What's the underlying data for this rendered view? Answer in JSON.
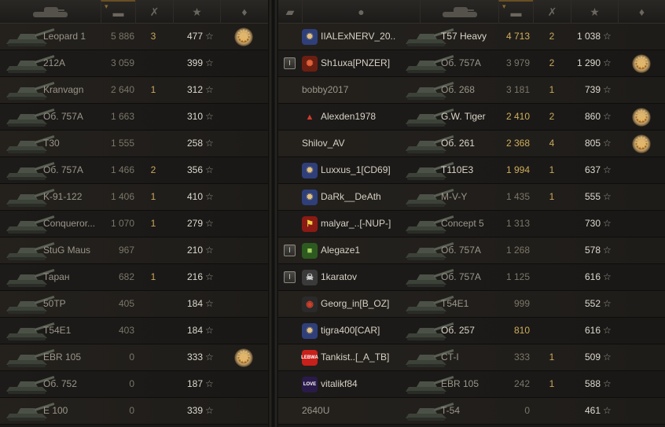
{
  "header": {
    "icons": [
      "clan-icon",
      "player-icon",
      "tank-icon",
      "damage-icon",
      "tracked-kills-icon",
      "experience-star-icon",
      "medal-icon"
    ],
    "sort_caret": "▾"
  },
  "star_glyph": "☆",
  "left_team": [
    {
      "tank": "Leopard 1",
      "damage": "5 886",
      "kills": "3",
      "xp": "477",
      "medal": true
    },
    {
      "tank": "212A",
      "damage": "3 059",
      "kills": "",
      "xp": "399",
      "medal": false
    },
    {
      "tank": "Kranvagn",
      "damage": "2 640",
      "kills": "1",
      "xp": "312",
      "medal": false
    },
    {
      "tank": "Об. 757A",
      "damage": "1 663",
      "kills": "",
      "xp": "310",
      "medal": false
    },
    {
      "tank": "T30",
      "damage": "1 555",
      "kills": "",
      "xp": "258",
      "medal": false
    },
    {
      "tank": "Об. 757A",
      "damage": "1 466",
      "kills": "2",
      "xp": "356",
      "medal": false
    },
    {
      "tank": "K-91-122",
      "damage": "1 406",
      "kills": "1",
      "xp": "410",
      "medal": false
    },
    {
      "tank": "Conqueror...",
      "damage": "1 070",
      "kills": "1",
      "xp": "279",
      "medal": false
    },
    {
      "tank": "StuG Maus",
      "damage": "967",
      "kills": "",
      "xp": "210",
      "medal": false
    },
    {
      "tank": "Таран",
      "damage": "682",
      "kills": "1",
      "xp": "216",
      "medal": false
    },
    {
      "tank": "50TP",
      "damage": "405",
      "kills": "",
      "xp": "184",
      "medal": false
    },
    {
      "tank": "T54E1",
      "damage": "403",
      "kills": "",
      "xp": "184",
      "medal": false
    },
    {
      "tank": "EBR 105",
      "damage": "0",
      "kills": "",
      "xp": "333",
      "medal": true
    },
    {
      "tank": "Об. 752",
      "damage": "0",
      "kills": "",
      "xp": "187",
      "medal": false
    },
    {
      "tank": "E 100",
      "damage": "0",
      "kills": "",
      "xp": "339",
      "medal": false
    }
  ],
  "right_team": [
    {
      "player": "IIALExNERV_20..",
      "badge": "",
      "clan": "medal",
      "tank": "T57 Heavy",
      "damage": "4 713",
      "kills": "2",
      "xp": "1 038",
      "medal": false,
      "hi": true
    },
    {
      "player": "Sh1uxa[PNZER]",
      "badge": "I",
      "clan": "red",
      "tank": "Об. 757A",
      "damage": "3 979",
      "kills": "2",
      "xp": "1 290",
      "medal": true,
      "hi": false
    },
    {
      "player": "bobby2017",
      "badge": "",
      "clan": "",
      "tank": "Об. 268",
      "damage": "3 181",
      "kills": "1",
      "xp": "739",
      "medal": false,
      "hi": false
    },
    {
      "player": "Alexden1978",
      "badge": "",
      "clan": "triangle",
      "tank": "G.W. Tiger",
      "damage": "2 410",
      "kills": "2",
      "xp": "860",
      "medal": true,
      "hi": true
    },
    {
      "player": "Shilov_AV",
      "badge": "",
      "clan": "",
      "tank": "Об. 261",
      "damage": "2 368",
      "kills": "4",
      "xp": "805",
      "medal": true,
      "hi": true
    },
    {
      "player": "Luxxus_1[CD69]",
      "badge": "",
      "clan": "medal",
      "tank": "T110E3",
      "damage": "1 994",
      "kills": "1",
      "xp": "637",
      "medal": false,
      "hi": true
    },
    {
      "player": "DaRk__DeAth",
      "badge": "",
      "clan": "medal",
      "tank": "M-V-Y",
      "damage": "1 435",
      "kills": "1",
      "xp": "555",
      "medal": false,
      "hi": false
    },
    {
      "player": "malyar_..[-NUP-]",
      "badge": "",
      "clan": "flag",
      "tank": "Concept 5",
      "damage": "1 313",
      "kills": "",
      "xp": "730",
      "medal": false,
      "hi": false
    },
    {
      "player": "Alegaze1",
      "badge": "I",
      "clan": "green",
      "tank": "Об. 757A",
      "damage": "1 268",
      "kills": "",
      "xp": "578",
      "medal": false,
      "hi": false
    },
    {
      "player": "1karatov",
      "badge": "I",
      "clan": "skull",
      "tank": "Об. 757A",
      "damage": "1 125",
      "kills": "",
      "xp": "616",
      "medal": false,
      "hi": false
    },
    {
      "player": "Georg_in[B_OZ]",
      "badge": "",
      "clan": "ring",
      "tank": "T54E1",
      "damage": "999",
      "kills": "",
      "xp": "552",
      "medal": false,
      "hi": false
    },
    {
      "player": "tigra400[CAR]",
      "badge": "",
      "clan": "medal",
      "tank": "Об. 257",
      "damage": "810",
      "kills": "",
      "xp": "616",
      "medal": false,
      "hi": true
    },
    {
      "player": "Tankist..[_A_TB]",
      "badge": "",
      "clan": "lebwa",
      "tank": "CT-I",
      "damage": "333",
      "kills": "1",
      "xp": "509",
      "medal": false,
      "hi": false
    },
    {
      "player": "vitalikf84",
      "badge": "",
      "clan": "love",
      "tank": "EBR 105",
      "damage": "242",
      "kills": "1",
      "xp": "588",
      "medal": false,
      "hi": false
    },
    {
      "player": "2640U",
      "badge": "",
      "clan": "",
      "tank": "T-54",
      "damage": "0",
      "kills": "",
      "xp": "461",
      "medal": false,
      "hi": false
    }
  ],
  "clan_text": {
    "lebwa": "LEBWA",
    "love": "LOVE",
    "badge_text": "I"
  }
}
